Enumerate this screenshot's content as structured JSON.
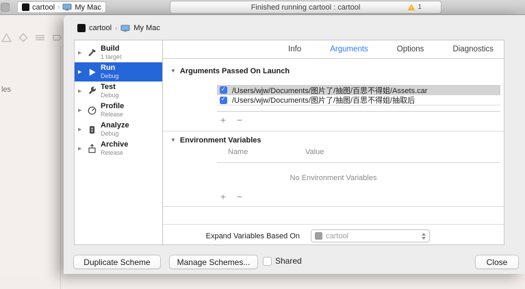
{
  "toolbar": {
    "scheme": "cartool",
    "destination": "My Mac",
    "status_message": "Finished running cartool : cartool",
    "warning_count": "1"
  },
  "background": {
    "clipped_text": "les"
  },
  "dialog": {
    "scheme": "cartool",
    "destination": "My Mac",
    "sidebar": [
      {
        "title": "Build",
        "subtitle": "1 target",
        "icon": "hammer-icon"
      },
      {
        "title": "Run",
        "subtitle": "Debug",
        "icon": "play-icon",
        "selected": true
      },
      {
        "title": "Test",
        "subtitle": "Debug",
        "icon": "wrench-icon"
      },
      {
        "title": "Profile",
        "subtitle": "Release",
        "icon": "gauge-icon"
      },
      {
        "title": "Analyze",
        "subtitle": "Debug",
        "icon": "analyzer-icon"
      },
      {
        "title": "Archive",
        "subtitle": "Release",
        "icon": "archive-icon"
      }
    ],
    "tabs": [
      {
        "label": "Info"
      },
      {
        "label": "Arguments",
        "active": true
      },
      {
        "label": "Options"
      },
      {
        "label": "Diagnostics"
      }
    ],
    "arguments_section": {
      "title": "Arguments Passed On Launch",
      "rows": [
        {
          "checked": true,
          "selected": true,
          "value": "/Users/wjw/Documents/图片了/抽图/百思不得姐/Assets.car"
        },
        {
          "checked": true,
          "selected": false,
          "value": "/Users/wjw/Documents/图片了/抽图/百思不得姐/抽取后"
        }
      ],
      "add": "+",
      "remove": "−"
    },
    "environment_section": {
      "title": "Environment Variables",
      "name_header": "Name",
      "value_header": "Value",
      "empty": "No Environment Variables",
      "add": "+",
      "remove": "−"
    },
    "expand_variables": {
      "label": "Expand Variables Based On",
      "value": "cartool"
    },
    "footer": {
      "duplicate": "Duplicate Scheme",
      "manage": "Manage Schemes...",
      "shared": "Shared",
      "close": "Close"
    }
  },
  "colors": {
    "accent_blue": "#2e7bf6",
    "selection_blue": "#2566d9",
    "checkbox_blue": "#3b76f0",
    "row_selection_gray": "#d3d3d3",
    "warning_yellow": "#fcb827"
  }
}
